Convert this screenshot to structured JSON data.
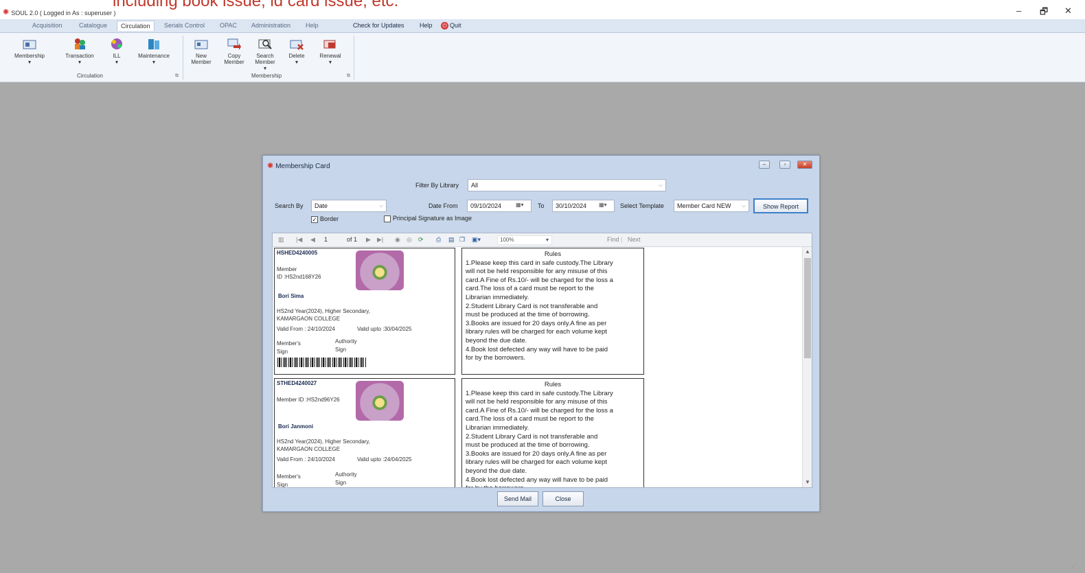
{
  "window": {
    "title": "SOUL 2.0  ( Logged in As : superuser )",
    "overlay_text": "including book issue, id card issue, etc.",
    "controls": {
      "minimize": "–",
      "maximize": "🗗",
      "close": "✕"
    }
  },
  "menu": {
    "tabs": [
      "Acquisition",
      "Catalogue",
      "Circulation",
      "Serials Control",
      "OPAC",
      "Administration",
      "Help"
    ],
    "active": "Circulation",
    "extras": {
      "updates": "Check for Updates",
      "help": "Help",
      "quit": "Quit"
    }
  },
  "ribbon": {
    "circulation_group": {
      "label": "Circulation",
      "buttons": [
        {
          "label": "Membership",
          "icon": "membership-card-icon"
        },
        {
          "label": "Transaction",
          "icon": "transaction-people-icon"
        },
        {
          "label": "ILL",
          "icon": "ill-network-icon"
        },
        {
          "label": "Maintenance",
          "icon": "maintenance-books-icon"
        }
      ]
    },
    "membership_group": {
      "label": "Membership",
      "buttons": [
        {
          "label": "New\nMember",
          "icon": "new-member-icon"
        },
        {
          "label": "Copy\nMember",
          "icon": "copy-member-icon"
        },
        {
          "label": "Search\nMember",
          "icon": "search-member-icon"
        },
        {
          "label": "Delete",
          "icon": "delete-member-icon"
        },
        {
          "label": "Renewal",
          "icon": "renewal-icon"
        }
      ]
    }
  },
  "dialog": {
    "title": "Membership Card",
    "filter_label": "Filter By Library",
    "filter_value": "All",
    "search_by_label": "Search By",
    "search_by_value": "Date",
    "date_from_label": "Date From",
    "date_from": "09/10/2024",
    "to_label": "To",
    "date_to": "30/10/2024",
    "template_label": "Select Template",
    "template_value": "Member Card NEW",
    "show_report": "Show Report",
    "border_label": "Border",
    "border_checked": true,
    "principal_label": "Principal Signature as Image",
    "principal_checked": false,
    "send_mail": "Send Mail",
    "close": "Close"
  },
  "viewer": {
    "page": "1",
    "of_pages": "of 1",
    "zoom": "100%",
    "find": "Find",
    "next": "Next"
  },
  "rules": {
    "title": "Rules",
    "lines": [
      "1.Please keep this card in safe custody.The Library",
      "will not be  held responsible for any misuse of this",
      "card.A Fine of Rs.10/- will be charged for the loss a",
      "card.The loss of a card must be report to the",
      "Librarian  immediately.",
      "2.Student Library Card is not  transferable and",
      "must be produced at the time of borrowing.",
      "3.Books are issued for 20 days only.A fine as per",
      "library rules will be charged for each volume kept",
      "beyond the due date.",
      "4.Book lost defected any way will have to be paid",
      "for by the borrowers."
    ]
  },
  "cards": [
    {
      "code": "HSHED4240005",
      "member_label": "Member",
      "member_id": "ID :HS2nd168Y26",
      "name": "Bori Sima",
      "course": "HS2nd Year(2024), Higher Secondary,",
      "college": "KAMARGAON COLLEGE",
      "valid_from": "Valid From : 24/10/2024",
      "valid_upto": "Valid upto :30/04/2025",
      "member_sign": "Member's\nSign",
      "authority_sign": "Authority\nSign"
    },
    {
      "code": "STHED4240027",
      "member_label": "",
      "member_id": "Member ID :HS2nd96Y26",
      "name": "Bori Janmoni",
      "course": "HS2nd Year(2024), Higher Secondary,",
      "college": "KAMARGAON COLLEGE",
      "valid_from": "Valid From : 24/10/2024",
      "valid_upto": "Valid upto :24/04/2025",
      "member_sign": "Member's\nSign",
      "authority_sign": "Authority\nSign"
    }
  ]
}
